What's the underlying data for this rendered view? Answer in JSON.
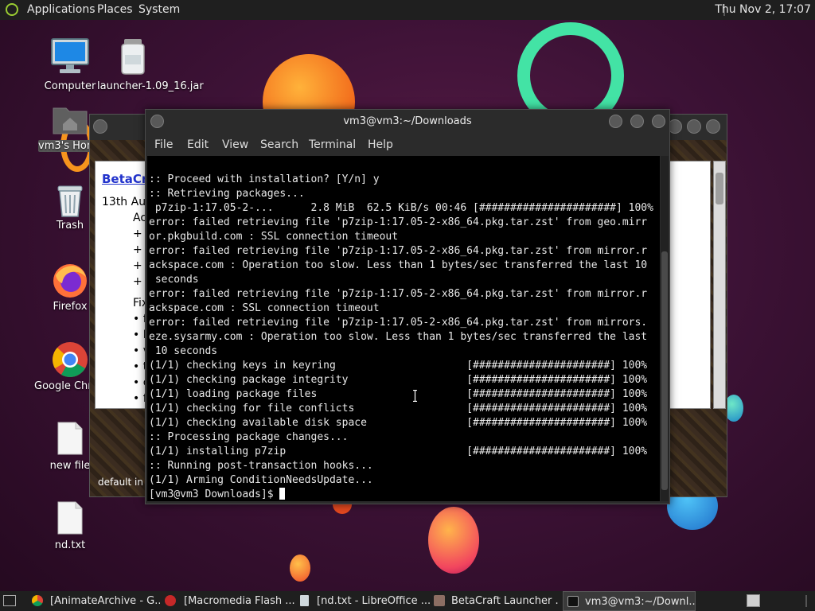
{
  "top_panel": {
    "menus": [
      "Applications",
      "Places",
      "System"
    ],
    "clock": "Thu Nov  2, 17:07"
  },
  "desktop_icons": [
    {
      "label": "Computer",
      "icon": "monitor-icon"
    },
    {
      "label": "launcher-1.09_16.jar",
      "icon": "jar-icon"
    },
    {
      "label": "vm3's Home",
      "icon": "home-folder-icon"
    },
    {
      "label": "Trash",
      "icon": "trash-icon"
    },
    {
      "label": "Firefox",
      "icon": "firefox-icon"
    },
    {
      "label": "Google Chrome",
      "icon": "chrome-icon"
    },
    {
      "label": "new file",
      "icon": "file-icon"
    },
    {
      "label": "nd.txt",
      "icon": "file-icon"
    }
  ],
  "betacraft_window": {
    "link_text": "BetaCraft",
    "date_text": "13th Aug",
    "lines": [
      "Ac",
      "+ (",
      "+ (",
      "+ I",
      "+ l",
      "Fix",
      "• fi",
      "• D",
      "• v",
      "• th",
      "• c",
      "• fi"
    ],
    "footer_text": "default in"
  },
  "terminal": {
    "title": "vm3@vm3:~/Downloads",
    "menus": [
      "File",
      "Edit",
      "View",
      "Search",
      "Terminal",
      "Help"
    ],
    "lines": [
      ":: Proceed with installation? [Y/n] y",
      ":: Retrieving packages...",
      " p7zip-1:17.05-2-...      2.8 MiB  62.5 KiB/s 00:46 [######################] 100%",
      "error: failed retrieving file 'p7zip-1:17.05-2-x86_64.pkg.tar.zst' from geo.mirr",
      "or.pkgbuild.com : SSL connection timeout",
      "error: failed retrieving file 'p7zip-1:17.05-2-x86_64.pkg.tar.zst' from mirror.r",
      "ackspace.com : Operation too slow. Less than 1 bytes/sec transferred the last 10",
      " seconds",
      "error: failed retrieving file 'p7zip-1:17.05-2-x86_64.pkg.tar.zst' from mirror.r",
      "ackspace.com : SSL connection timeout",
      "error: failed retrieving file 'p7zip-1:17.05-2-x86_64.pkg.tar.zst' from mirrors.",
      "eze.sysarmy.com : Operation too slow. Less than 1 bytes/sec transferred the last",
      " 10 seconds",
      "(1/1) checking keys in keyring                     [######################] 100%",
      "(1/1) checking package integrity                   [######################] 100%",
      "(1/1) loading package files                        [######################] 100%",
      "(1/1) checking for file conflicts                  [######################] 100%",
      "(1/1) checking available disk space                [######################] 100%",
      ":: Processing package changes...",
      "(1/1) installing p7zip                             [######################] 100%",
      ":: Running post-transaction hooks...",
      "(1/1) Arming ConditionNeedsUpdate..."
    ],
    "prompt": "[vm3@vm3 Downloads]$ "
  },
  "taskbar": {
    "tasks": [
      {
        "label": "[AnimateArchive - G...",
        "icon": "chrome-icon"
      },
      {
        "label": "[Macromedia Flash ...",
        "icon": "flash-icon"
      },
      {
        "label": "[nd.txt - LibreOffice ...",
        "icon": "document-icon"
      },
      {
        "label": "BetaCraft Launcher ...",
        "icon": "java-icon"
      },
      {
        "label": "vm3@vm3:~/Downl...",
        "icon": "terminal-icon"
      }
    ]
  },
  "colors": {
    "panel": "#1f1f1f",
    "terminal_bg": "#000000",
    "terminal_fg": "#e8e8e8",
    "wallpaper": "#3d1236"
  }
}
